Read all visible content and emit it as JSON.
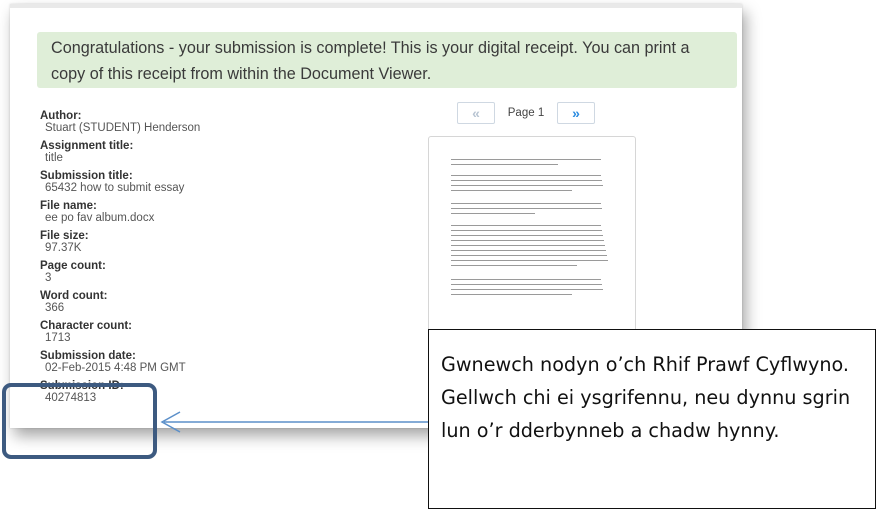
{
  "banner": {
    "message": "Congratulations - your submission is complete! This is your digital receipt. You can print a copy of this receipt from within the Document Viewer."
  },
  "receipt": {
    "fields": [
      {
        "label": "Author:",
        "value": "Stuart (STUDENT) Henderson"
      },
      {
        "label": "Assignment title:",
        "value": "title"
      },
      {
        "label": "Submission title:",
        "value": "65432 how to submit essay"
      },
      {
        "label": "File name:",
        "value": "ee po fav album.docx"
      },
      {
        "label": "File size:",
        "value": "97.37K"
      },
      {
        "label": "Page count:",
        "value": "3"
      },
      {
        "label": "Word count:",
        "value": "366"
      },
      {
        "label": "Character count:",
        "value": "1713"
      },
      {
        "label": "Submission date:",
        "value": "02-Feb-2015 4:48 PM GMT"
      },
      {
        "label": "Submission ID:",
        "value": "40274813"
      }
    ]
  },
  "pager": {
    "prev_symbol": "«",
    "page_label": "Page 1",
    "next_symbol": "»"
  },
  "callout": {
    "text": "Gwnewch nodyn o’ch Rhif Prawf Cyflwyno. Gellwch chi ei ysgrifennu, neu dynnu sgrin lun o’r dderbynneb a chadw hynny."
  },
  "colors": {
    "banner_bg": "#dfeed8",
    "highlight_border": "#3d5a80",
    "arrow": "#5b8fc9",
    "pager_next": "#2a8be0"
  }
}
